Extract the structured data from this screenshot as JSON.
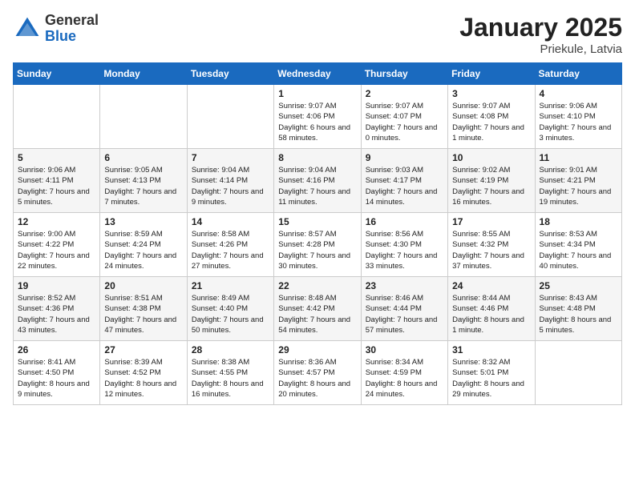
{
  "logo": {
    "general": "General",
    "blue": "Blue"
  },
  "calendar": {
    "title": "January 2025",
    "subtitle": "Priekule, Latvia"
  },
  "days_of_week": [
    "Sunday",
    "Monday",
    "Tuesday",
    "Wednesday",
    "Thursday",
    "Friday",
    "Saturday"
  ],
  "weeks": [
    [
      {
        "day": "",
        "sunrise": "",
        "sunset": "",
        "daylight": ""
      },
      {
        "day": "",
        "sunrise": "",
        "sunset": "",
        "daylight": ""
      },
      {
        "day": "",
        "sunrise": "",
        "sunset": "",
        "daylight": ""
      },
      {
        "day": "1",
        "sunrise": "Sunrise: 9:07 AM",
        "sunset": "Sunset: 4:06 PM",
        "daylight": "Daylight: 6 hours and 58 minutes."
      },
      {
        "day": "2",
        "sunrise": "Sunrise: 9:07 AM",
        "sunset": "Sunset: 4:07 PM",
        "daylight": "Daylight: 7 hours and 0 minutes."
      },
      {
        "day": "3",
        "sunrise": "Sunrise: 9:07 AM",
        "sunset": "Sunset: 4:08 PM",
        "daylight": "Daylight: 7 hours and 1 minute."
      },
      {
        "day": "4",
        "sunrise": "Sunrise: 9:06 AM",
        "sunset": "Sunset: 4:10 PM",
        "daylight": "Daylight: 7 hours and 3 minutes."
      }
    ],
    [
      {
        "day": "5",
        "sunrise": "Sunrise: 9:06 AM",
        "sunset": "Sunset: 4:11 PM",
        "daylight": "Daylight: 7 hours and 5 minutes."
      },
      {
        "day": "6",
        "sunrise": "Sunrise: 9:05 AM",
        "sunset": "Sunset: 4:13 PM",
        "daylight": "Daylight: 7 hours and 7 minutes."
      },
      {
        "day": "7",
        "sunrise": "Sunrise: 9:04 AM",
        "sunset": "Sunset: 4:14 PM",
        "daylight": "Daylight: 7 hours and 9 minutes."
      },
      {
        "day": "8",
        "sunrise": "Sunrise: 9:04 AM",
        "sunset": "Sunset: 4:16 PM",
        "daylight": "Daylight: 7 hours and 11 minutes."
      },
      {
        "day": "9",
        "sunrise": "Sunrise: 9:03 AM",
        "sunset": "Sunset: 4:17 PM",
        "daylight": "Daylight: 7 hours and 14 minutes."
      },
      {
        "day": "10",
        "sunrise": "Sunrise: 9:02 AM",
        "sunset": "Sunset: 4:19 PM",
        "daylight": "Daylight: 7 hours and 16 minutes."
      },
      {
        "day": "11",
        "sunrise": "Sunrise: 9:01 AM",
        "sunset": "Sunset: 4:21 PM",
        "daylight": "Daylight: 7 hours and 19 minutes."
      }
    ],
    [
      {
        "day": "12",
        "sunrise": "Sunrise: 9:00 AM",
        "sunset": "Sunset: 4:22 PM",
        "daylight": "Daylight: 7 hours and 22 minutes."
      },
      {
        "day": "13",
        "sunrise": "Sunrise: 8:59 AM",
        "sunset": "Sunset: 4:24 PM",
        "daylight": "Daylight: 7 hours and 24 minutes."
      },
      {
        "day": "14",
        "sunrise": "Sunrise: 8:58 AM",
        "sunset": "Sunset: 4:26 PM",
        "daylight": "Daylight: 7 hours and 27 minutes."
      },
      {
        "day": "15",
        "sunrise": "Sunrise: 8:57 AM",
        "sunset": "Sunset: 4:28 PM",
        "daylight": "Daylight: 7 hours and 30 minutes."
      },
      {
        "day": "16",
        "sunrise": "Sunrise: 8:56 AM",
        "sunset": "Sunset: 4:30 PM",
        "daylight": "Daylight: 7 hours and 33 minutes."
      },
      {
        "day": "17",
        "sunrise": "Sunrise: 8:55 AM",
        "sunset": "Sunset: 4:32 PM",
        "daylight": "Daylight: 7 hours and 37 minutes."
      },
      {
        "day": "18",
        "sunrise": "Sunrise: 8:53 AM",
        "sunset": "Sunset: 4:34 PM",
        "daylight": "Daylight: 7 hours and 40 minutes."
      }
    ],
    [
      {
        "day": "19",
        "sunrise": "Sunrise: 8:52 AM",
        "sunset": "Sunset: 4:36 PM",
        "daylight": "Daylight: 7 hours and 43 minutes."
      },
      {
        "day": "20",
        "sunrise": "Sunrise: 8:51 AM",
        "sunset": "Sunset: 4:38 PM",
        "daylight": "Daylight: 7 hours and 47 minutes."
      },
      {
        "day": "21",
        "sunrise": "Sunrise: 8:49 AM",
        "sunset": "Sunset: 4:40 PM",
        "daylight": "Daylight: 7 hours and 50 minutes."
      },
      {
        "day": "22",
        "sunrise": "Sunrise: 8:48 AM",
        "sunset": "Sunset: 4:42 PM",
        "daylight": "Daylight: 7 hours and 54 minutes."
      },
      {
        "day": "23",
        "sunrise": "Sunrise: 8:46 AM",
        "sunset": "Sunset: 4:44 PM",
        "daylight": "Daylight: 7 hours and 57 minutes."
      },
      {
        "day": "24",
        "sunrise": "Sunrise: 8:44 AM",
        "sunset": "Sunset: 4:46 PM",
        "daylight": "Daylight: 8 hours and 1 minute."
      },
      {
        "day": "25",
        "sunrise": "Sunrise: 8:43 AM",
        "sunset": "Sunset: 4:48 PM",
        "daylight": "Daylight: 8 hours and 5 minutes."
      }
    ],
    [
      {
        "day": "26",
        "sunrise": "Sunrise: 8:41 AM",
        "sunset": "Sunset: 4:50 PM",
        "daylight": "Daylight: 8 hours and 9 minutes."
      },
      {
        "day": "27",
        "sunrise": "Sunrise: 8:39 AM",
        "sunset": "Sunset: 4:52 PM",
        "daylight": "Daylight: 8 hours and 12 minutes."
      },
      {
        "day": "28",
        "sunrise": "Sunrise: 8:38 AM",
        "sunset": "Sunset: 4:55 PM",
        "daylight": "Daylight: 8 hours and 16 minutes."
      },
      {
        "day": "29",
        "sunrise": "Sunrise: 8:36 AM",
        "sunset": "Sunset: 4:57 PM",
        "daylight": "Daylight: 8 hours and 20 minutes."
      },
      {
        "day": "30",
        "sunrise": "Sunrise: 8:34 AM",
        "sunset": "Sunset: 4:59 PM",
        "daylight": "Daylight: 8 hours and 24 minutes."
      },
      {
        "day": "31",
        "sunrise": "Sunrise: 8:32 AM",
        "sunset": "Sunset: 5:01 PM",
        "daylight": "Daylight: 8 hours and 29 minutes."
      },
      {
        "day": "",
        "sunrise": "",
        "sunset": "",
        "daylight": ""
      }
    ]
  ]
}
